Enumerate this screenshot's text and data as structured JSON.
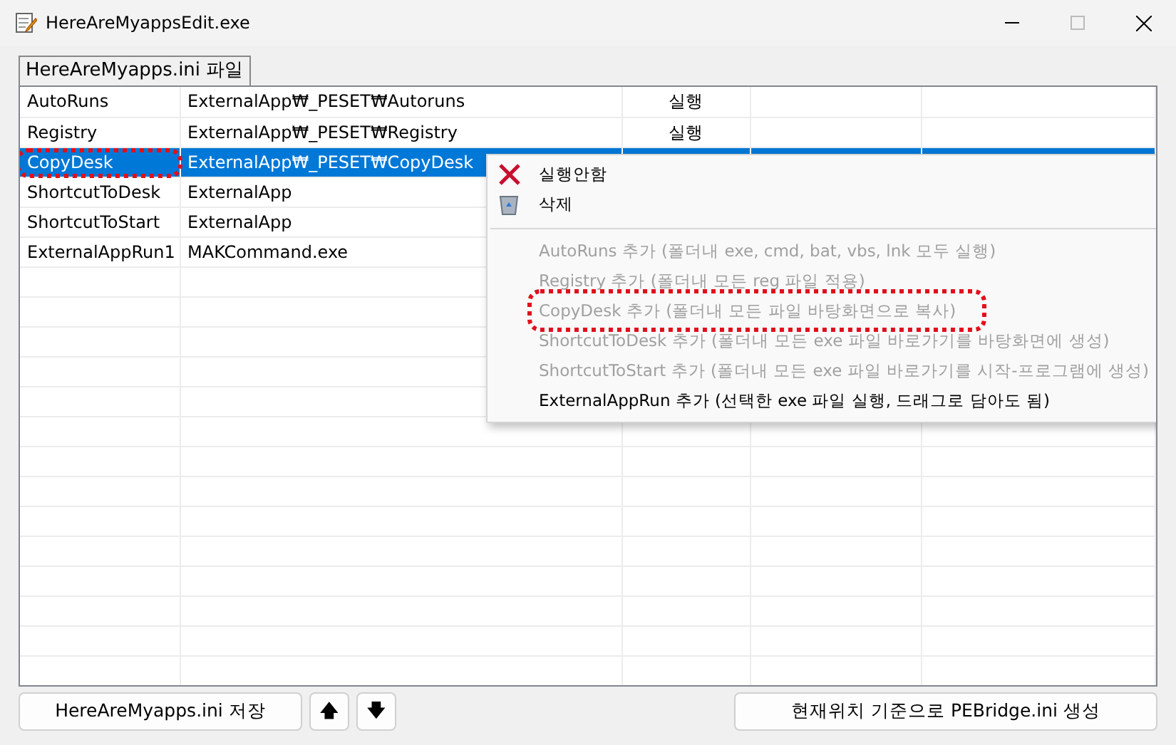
{
  "window": {
    "title": "HereAreMyappsEdit.exe",
    "maximize_enabled": false
  },
  "tab": {
    "label": "HereAreMyapps.ini 파일"
  },
  "table": {
    "rows": [
      {
        "cells": [
          "AutoRuns",
          "ExternalApp₩_PESET₩Autoruns",
          "실행",
          "",
          ""
        ],
        "selected": false,
        "highlighted": false
      },
      {
        "cells": [
          "Registry",
          "ExternalApp₩_PESET₩Registry",
          "실행",
          "",
          ""
        ],
        "selected": false,
        "highlighted": false
      },
      {
        "cells": [
          "CopyDesk",
          "ExternalApp₩_PESET₩CopyDesk",
          "",
          "",
          ""
        ],
        "selected": true,
        "highlighted": true
      },
      {
        "cells": [
          "ShortcutToDesk",
          "ExternalApp",
          "",
          "",
          ""
        ],
        "selected": false,
        "highlighted": false
      },
      {
        "cells": [
          "ShortcutToStart",
          "ExternalApp",
          "",
          "",
          ""
        ],
        "selected": false,
        "highlighted": false
      },
      {
        "cells": [
          "ExternalAppRun1",
          "MAKCommand.exe",
          "",
          "",
          ""
        ],
        "selected": false,
        "highlighted": false
      }
    ]
  },
  "context_menu": {
    "items": [
      {
        "kind": "cancel",
        "label": "실행안함",
        "disabled": false,
        "highlighted": false
      },
      {
        "kind": "delete",
        "label": "삭제",
        "disabled": false,
        "highlighted": false
      },
      {
        "kind": "separator"
      },
      {
        "kind": "add",
        "label": "AutoRuns 추가 (폴더내 exe, cmd, bat, vbs, lnk 모두 실행)",
        "disabled": true,
        "highlighted": false
      },
      {
        "kind": "add",
        "label": "Registry 추가 (폴더내 모든 reg 파일 적용)",
        "disabled": true,
        "highlighted": false
      },
      {
        "kind": "add",
        "label": "CopyDesk 추가 (폴더내 모든 파일 바탕화면으로 복사)",
        "disabled": true,
        "highlighted": true
      },
      {
        "kind": "add",
        "label": "ShortcutToDesk 추가 (폴더내 모든 exe 파일 바로가기를 바탕화면에 생성)",
        "disabled": true,
        "highlighted": false
      },
      {
        "kind": "add",
        "label": "ShortcutToStart 추가 (폴더내 모든 exe 파일 바로가기를 시작-프로그램에 생성)",
        "disabled": true,
        "highlighted": false
      },
      {
        "kind": "add",
        "label": "ExternalAppRun 추가 (선택한 exe 파일 실행, 드래그로 담아도 됨)",
        "disabled": false,
        "highlighted": false
      }
    ]
  },
  "buttons": {
    "save": "HereAreMyapps.ini 저장",
    "up": "🡅",
    "down": "🡇",
    "generate": "현재위치 기준으로 PEBridge.ini 생성"
  }
}
